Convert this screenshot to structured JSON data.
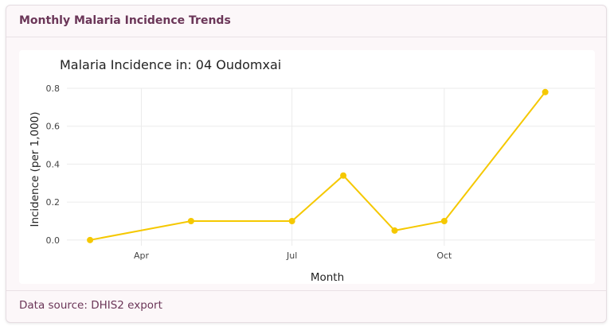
{
  "card": {
    "title": "Monthly Malaria Incidence Trends",
    "footer": "Data source: DHIS2 export"
  },
  "chart_data": {
    "type": "line",
    "title": "Malaria Incidence in: 04 Oudomxai",
    "xlabel": "Month",
    "ylabel": "Incidence (per 1,000)",
    "x": [
      "2023-03-01",
      "2023-05-01",
      "2023-07-01",
      "2023-08-01",
      "2023-09-01",
      "2023-10-01",
      "2023-12-01"
    ],
    "values": [
      0.0,
      0.1,
      0.1,
      0.34,
      0.05,
      0.1,
      0.78
    ],
    "xlim": [
      "2023-02-15",
      "2023-12-31"
    ],
    "ylim": [
      -0.03,
      0.8
    ],
    "x_ticks": [
      {
        "date": "2023-04-01",
        "label": "Apr"
      },
      {
        "date": "2023-07-01",
        "label": "Jul"
      },
      {
        "date": "2023-10-01",
        "label": "Oct"
      }
    ],
    "y_ticks": [
      {
        "value": 0,
        "label": "0.0"
      },
      {
        "value": 0.2,
        "label": "0.2"
      },
      {
        "value": 0.4,
        "label": "0.4"
      },
      {
        "value": 0.6,
        "label": "0.6"
      },
      {
        "value": 0.8,
        "label": "0.8"
      }
    ],
    "grid": true,
    "line_color": "#f5c800"
  }
}
